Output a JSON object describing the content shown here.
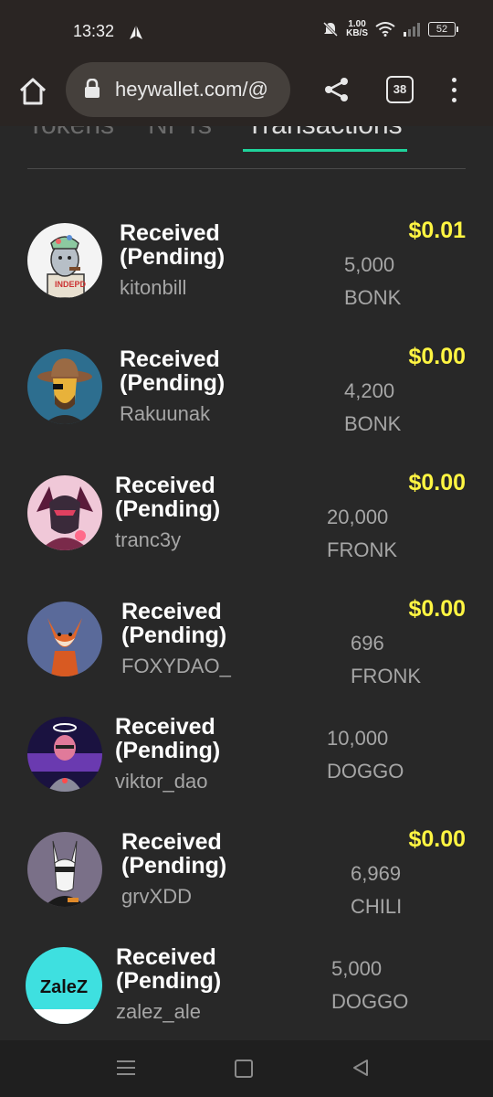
{
  "status_bar": {
    "time": "13:32",
    "net_speed_value": "1.00",
    "net_speed_unit": "KB/S",
    "battery": "52"
  },
  "browser": {
    "url": "heywallet.com/@",
    "tab_count": "38"
  },
  "tabs": [
    {
      "label": "Tokens",
      "active": false
    },
    {
      "label": "NFTs",
      "active": false
    },
    {
      "label": "Transactions",
      "active": true
    }
  ],
  "transactions": [
    {
      "status_line1": "Received",
      "status_line2": "(Pending)",
      "user": "kitonbill",
      "usd": "$0.01",
      "amount": "5,000",
      "token": "BONK"
    },
    {
      "status_line1": "Received",
      "status_line2": "(Pending)",
      "user": "Rakuunak",
      "usd": "$0.00",
      "amount": "4,200",
      "token": "BONK"
    },
    {
      "status_line1": "Received",
      "status_line2": "(Pending)",
      "user": "tranc3y",
      "usd": "$0.00",
      "amount": "20,000",
      "token": "FRONK"
    },
    {
      "status_line1": "Received",
      "status_line2": "(Pending)",
      "user": "FOXYDAO_",
      "usd": "$0.00",
      "amount": "696",
      "token": "FRONK"
    },
    {
      "status_line1": "Received",
      "status_line2": "(Pending)",
      "user": "viktor_dao",
      "usd": "",
      "amount": "10,000",
      "token": "DOGGO"
    },
    {
      "status_line1": "Received",
      "status_line2": "(Pending)",
      "user": "grvXDD",
      "usd": "$0.00",
      "amount": "6,969",
      "token": "CHILI"
    },
    {
      "status_line1": "Received",
      "status_line2": "(Pending)",
      "user": "zalez_ale",
      "usd": "",
      "amount": "5,000",
      "token": "DOGGO",
      "avatar_text": "ZaleZ"
    }
  ],
  "colors": {
    "accent": "#1fd39b",
    "usd_value": "#fff542",
    "background": "#282828"
  }
}
